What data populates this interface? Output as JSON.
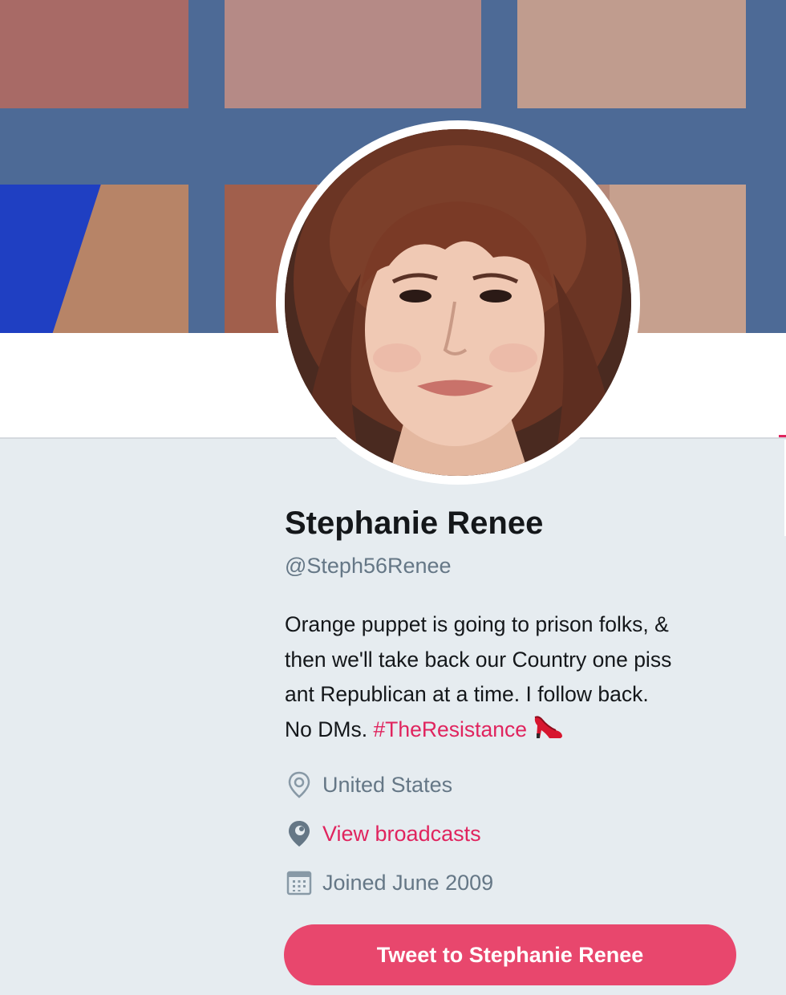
{
  "profile": {
    "name": "Stephanie Renee",
    "handle": "@Steph56Renee",
    "bio": {
      "line1": "Orange puppet is going to prison folks, &",
      "line2": "then we'll take back our Country one piss",
      "line3": "ant Republican at a time. I follow back.",
      "line4_prefix": "No DMs. ",
      "hashtag": "#TheResistance",
      "emoji": "high-heel-shoe-icon"
    },
    "location": "United States",
    "broadcasts_link": "View broadcasts",
    "joined": "Joined June 2009"
  },
  "actions": {
    "tweet_to": "Tweet to Stephanie Renee"
  },
  "icons": {
    "location": "location-pin-icon",
    "broadcasts": "periscope-icon",
    "joined": "calendar-icon"
  },
  "colors": {
    "accent": "#e0245e",
    "button": "#e8476d",
    "secondary_text": "#657786",
    "primary_text": "#14171a",
    "page_background": "#e6ecf0"
  }
}
